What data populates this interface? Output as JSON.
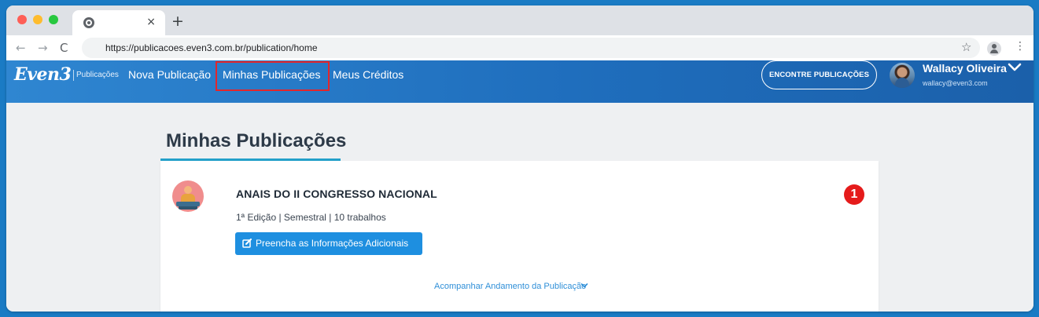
{
  "browser": {
    "tab_close": "×",
    "new_tab": "+",
    "back": "←",
    "forward": "→",
    "reload": "C",
    "url": "https://publicacoes.even3.com.br/publication/home",
    "star": "☆",
    "menu": "⋮"
  },
  "header": {
    "logo": "Even3",
    "logo_sub": "Publicações",
    "nav": {
      "nova": "Nova Publicação",
      "minhas": "Minhas Publicações",
      "creditos": "Meus Créditos"
    },
    "search_button": "ENCONTRE PUBLICAÇÕES",
    "user": {
      "name": "Wallacy Oliveira",
      "email": "wallacy@even3.com"
    }
  },
  "page": {
    "title": "Minhas Publicações"
  },
  "publication": {
    "title": "ANAIS DO II CONGRESSO NACIONAL",
    "meta": "1ª Edição | Semestral | 10 trabalhos",
    "action_button": "Preencha as Informações Adicionais",
    "badge": "1",
    "track_link": "Acompanhar Andamento da Publicação"
  },
  "colors": {
    "header_blue": "#1f6ebd",
    "accent_underline": "#23a0c9",
    "primary_button": "#1e8fe0",
    "badge_red": "#e51b1b",
    "highlight_red": "#e3262b"
  }
}
